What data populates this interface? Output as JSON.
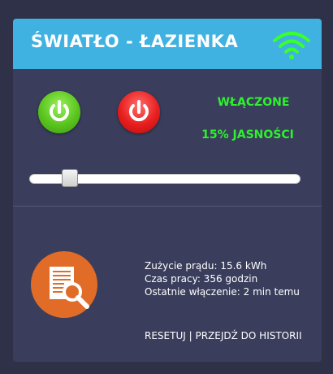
{
  "header": {
    "title": "ŚWIATŁO - ŁAZIENKA",
    "wifi_icon": "wifi-icon",
    "wifi_color": "#3aff2e",
    "background": "#3fb2e1"
  },
  "controls": {
    "on_button_icon": "power-icon",
    "off_button_icon": "power-icon",
    "status_text": "WŁĄCZONE",
    "brightness_text": "15% JASNOŚCI",
    "brightness_level": 15,
    "status_color": "#2ef02e"
  },
  "stats": {
    "power_usage": "Zużycie prądu: 15.6 kWh",
    "runtime": "Czas pracy: 356 godzin",
    "last_on": "Ostatnie włączenie: 2 min temu"
  },
  "history": {
    "icon": "document-search-icon",
    "icon_color": "#e06c28",
    "reset_label": "RESETUJ",
    "separator": "|",
    "history_label": "PRZEJDŹ DO HISTORII"
  }
}
